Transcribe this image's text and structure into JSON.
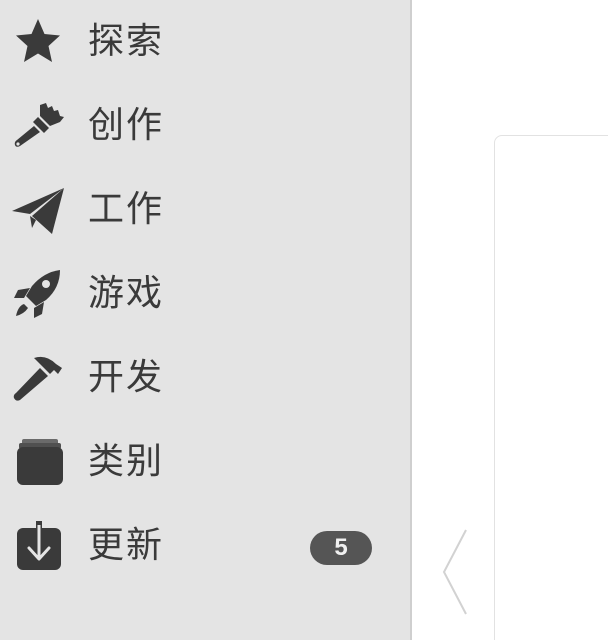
{
  "sidebar": {
    "items": [
      {
        "label": "探索",
        "icon": "star-icon"
      },
      {
        "label": "创作",
        "icon": "paintbrush-icon"
      },
      {
        "label": "工作",
        "icon": "paper-plane-icon"
      },
      {
        "label": "游戏",
        "icon": "rocket-icon"
      },
      {
        "label": "开发",
        "icon": "hammer-icon"
      },
      {
        "label": "类别",
        "icon": "stack-icon"
      },
      {
        "label": "更新",
        "icon": "download-icon",
        "badge": "5"
      }
    ]
  },
  "colors": {
    "sidebar_bg": "#e4e4e4",
    "icon": "#3a3a3a",
    "badge_bg": "#555555",
    "content_bg": "#ffffff"
  },
  "content": {
    "nav_icon": "chevron-left-icon"
  }
}
